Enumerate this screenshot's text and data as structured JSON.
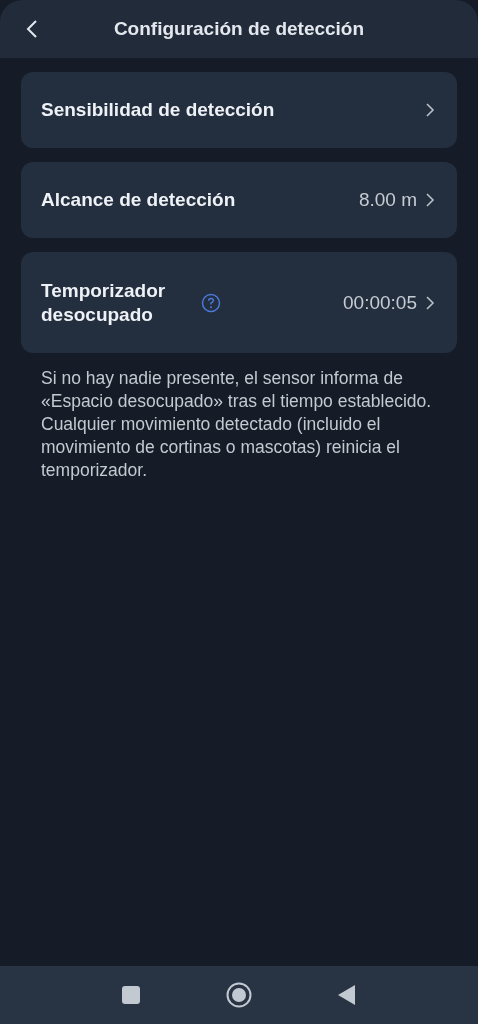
{
  "header": {
    "title": "Configuración de detección"
  },
  "items": [
    {
      "label": "Sensibilidad de detección",
      "help": false
    },
    {
      "label": "Alcance de detección",
      "value": "8.00 m",
      "help": false
    },
    {
      "label": "Temporizador desocupado",
      "value": "00:00:05",
      "help": true
    }
  ],
  "description": "Si no hay nadie presente, el sensor informa de «Espacio desocupado» tras el tiempo establecido. Cualquier movimiento detectado (incluido el movimiento de cortinas o mascotas) reinicia el temporizador."
}
